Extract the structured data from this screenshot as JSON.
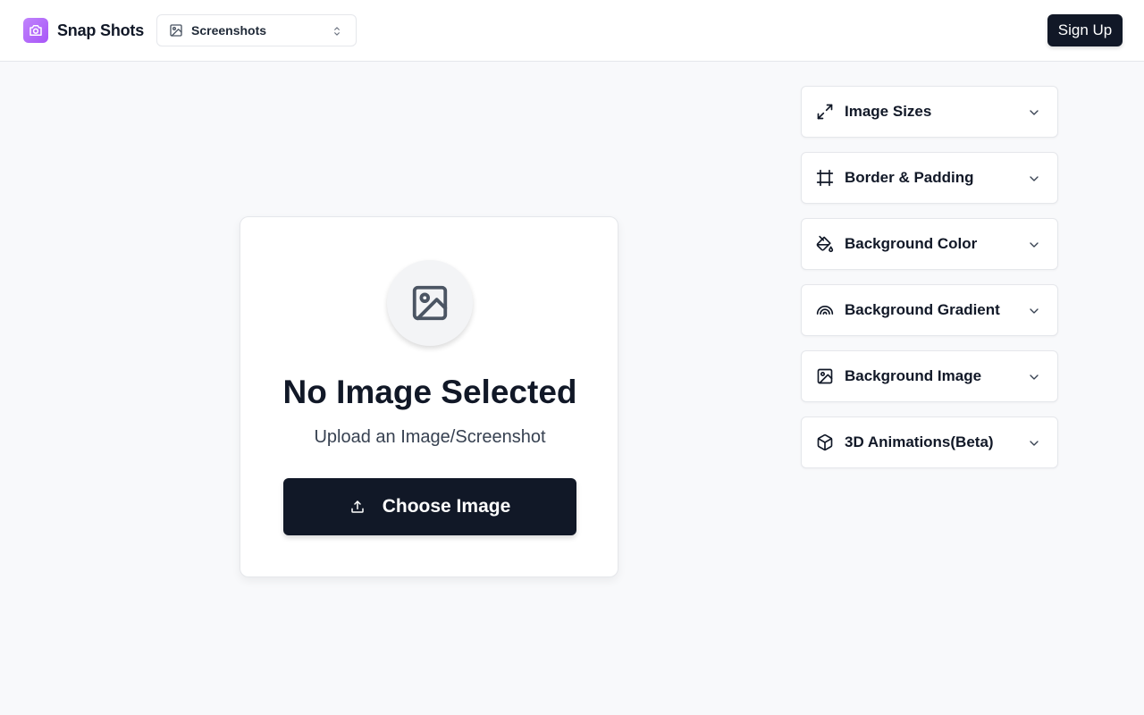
{
  "header": {
    "brand": "Snap Shots",
    "mode_select": {
      "value": "Screenshots",
      "icon": "image-icon"
    },
    "signup_label": "Sign Up"
  },
  "upload_card": {
    "icon": "image-icon",
    "title": "No Image Selected",
    "subtitle": "Upload an Image/Screenshot",
    "button_label": "Choose Image",
    "button_icon": "upload-icon"
  },
  "settings_panels": [
    {
      "label": "Image Sizes",
      "icon": "expand-arrows-icon"
    },
    {
      "label": "Border & Padding",
      "icon": "frame-icon"
    },
    {
      "label": "Background Color",
      "icon": "paint-bucket-icon"
    },
    {
      "label": "Background Gradient",
      "icon": "rainbow-icon"
    },
    {
      "label": "Background Image",
      "icon": "image-icon"
    },
    {
      "label": "3D Animations(Beta)",
      "icon": "cube-icon"
    }
  ],
  "colors": {
    "brand_gradient_start": "#c084fc",
    "brand_gradient_end": "#a855f7",
    "primary_dark": "#111827",
    "page_background": "#f8f9fb"
  }
}
